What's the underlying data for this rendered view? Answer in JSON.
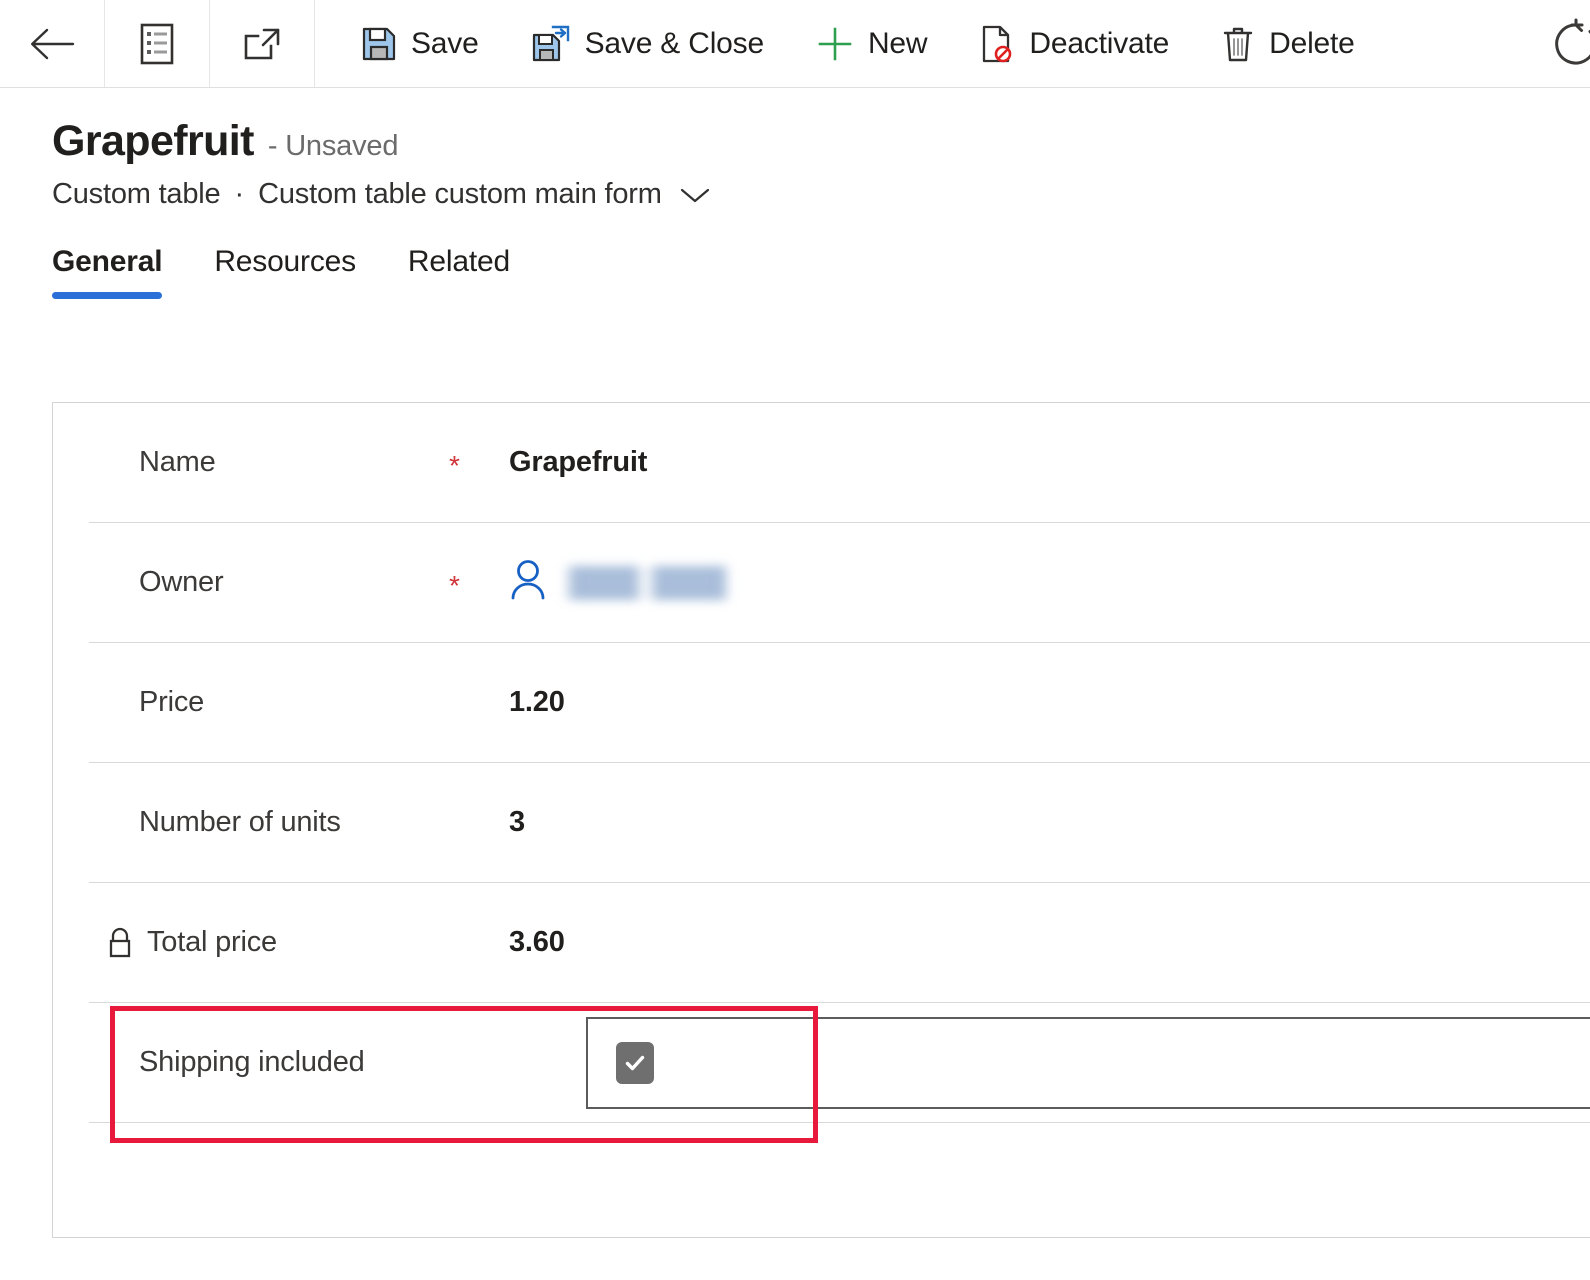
{
  "commandbar": {
    "back": {
      "label": "Back",
      "icon": "back-arrow-icon"
    },
    "show_chart": {
      "label": "Show Chart",
      "icon": "list-form-icon"
    },
    "open_new_window": {
      "label": "Open in new window",
      "icon": "open-external-icon"
    },
    "buttons": [
      {
        "id": "save",
        "label": "Save",
        "icon": "save-disk-icon"
      },
      {
        "id": "save-close",
        "label": "Save & Close",
        "icon": "save-and-close-icon"
      },
      {
        "id": "new",
        "label": "New",
        "icon": "plus-icon"
      },
      {
        "id": "deactivate",
        "label": "Deactivate",
        "icon": "deactivate-document-icon"
      },
      {
        "id": "delete",
        "label": "Delete",
        "icon": "trash-icon"
      }
    ],
    "refresh": {
      "label": "Refresh",
      "icon": "refresh-icon"
    }
  },
  "header": {
    "record_title": "Grapefruit",
    "unsaved_label": "- Unsaved",
    "table_name": "Custom table",
    "separator": "·",
    "form_name": "Custom table custom main form",
    "form_caret": "chevron-down-icon"
  },
  "tabs": [
    {
      "id": "general",
      "label": "General",
      "active": true
    },
    {
      "id": "resources",
      "label": "Resources",
      "active": false
    },
    {
      "id": "related",
      "label": "Related",
      "active": false
    }
  ],
  "form": {
    "rows": [
      {
        "id": "name",
        "label": "Name",
        "required": "*",
        "value": "Grapefruit",
        "type": "text"
      },
      {
        "id": "owner",
        "label": "Owner",
        "required": "*",
        "value": "",
        "type": "lookup",
        "icon": "person-icon",
        "redacted": true
      },
      {
        "id": "price",
        "label": "Price",
        "required": "",
        "value": "1.20",
        "type": "number"
      },
      {
        "id": "units",
        "label": "Number of units",
        "required": "",
        "value": "3",
        "type": "number"
      },
      {
        "id": "total-price",
        "label": "Total price",
        "required": "",
        "value": "3.60",
        "type": "number",
        "locked": true,
        "lock_icon": "lock-icon"
      },
      {
        "id": "shipping",
        "label": "Shipping included",
        "required": "",
        "value": "",
        "type": "checkbox",
        "checked": true,
        "check_glyph": "✔"
      }
    ]
  },
  "annotation": {
    "highlight_color": "#e81a3b",
    "target_row": "shipping"
  },
  "colors": {
    "accent": "#2b6fd9",
    "required_star": "#d13438",
    "annotation": "#e81a3b",
    "checkbox_fill": "#6f6f6f",
    "plus_green": "#2e9e4f",
    "save_blue": "#7aabdd",
    "person_blue": "#1760c4"
  }
}
